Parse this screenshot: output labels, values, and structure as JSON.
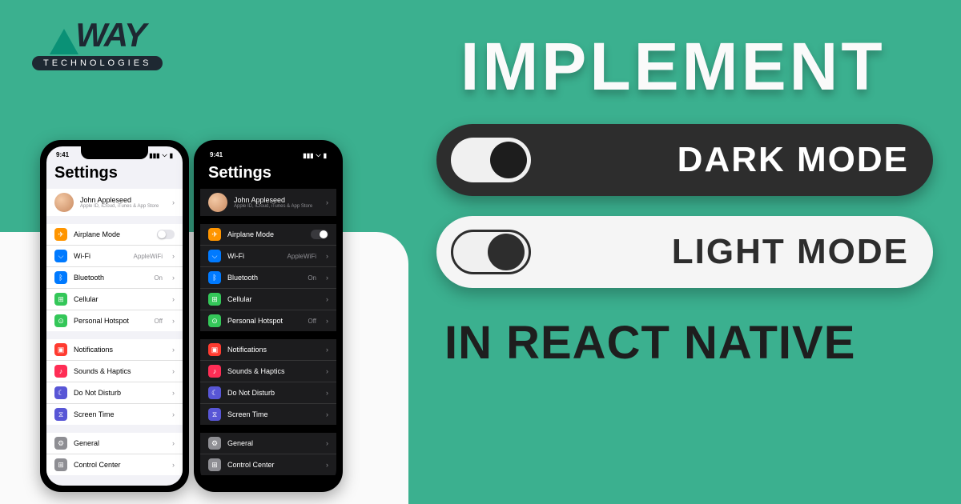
{
  "logo": {
    "brand": "WAY",
    "sub": "TECHNOLOGIES"
  },
  "headline": "IMPLEMENT",
  "pills": {
    "dark": "DARK MODE",
    "light": "LIGHT MODE"
  },
  "subhead": "IN REACT NATIVE",
  "phone": {
    "time": "9:41",
    "title": "Settings",
    "profile": {
      "name": "John Appleseed",
      "sub": "Apple ID, iCloud, iTunes & App Store"
    },
    "group1": [
      {
        "icon": "✈",
        "color": "#ff9500",
        "label": "Airplane Mode",
        "toggle": true
      },
      {
        "icon": "⌵",
        "color": "#007aff",
        "label": "Wi-Fi",
        "val": "AppleWiFi"
      },
      {
        "icon": "ᛒ",
        "color": "#007aff",
        "label": "Bluetooth",
        "val": "On"
      },
      {
        "icon": "⊞",
        "color": "#34c759",
        "label": "Cellular",
        "val": ""
      },
      {
        "icon": "⊙",
        "color": "#34c759",
        "label": "Personal Hotspot",
        "val": "Off"
      }
    ],
    "group2": [
      {
        "icon": "▣",
        "color": "#ff3b30",
        "label": "Notifications"
      },
      {
        "icon": "♪",
        "color": "#ff2d55",
        "label": "Sounds & Haptics"
      },
      {
        "icon": "☾",
        "color": "#5856d6",
        "label": "Do Not Disturb"
      },
      {
        "icon": "⧖",
        "color": "#5856d6",
        "label": "Screen Time"
      }
    ],
    "group3": [
      {
        "icon": "⚙",
        "color": "#8e8e93",
        "label": "General"
      },
      {
        "icon": "⊞",
        "color": "#8e8e93",
        "label": "Control Center"
      }
    ]
  }
}
